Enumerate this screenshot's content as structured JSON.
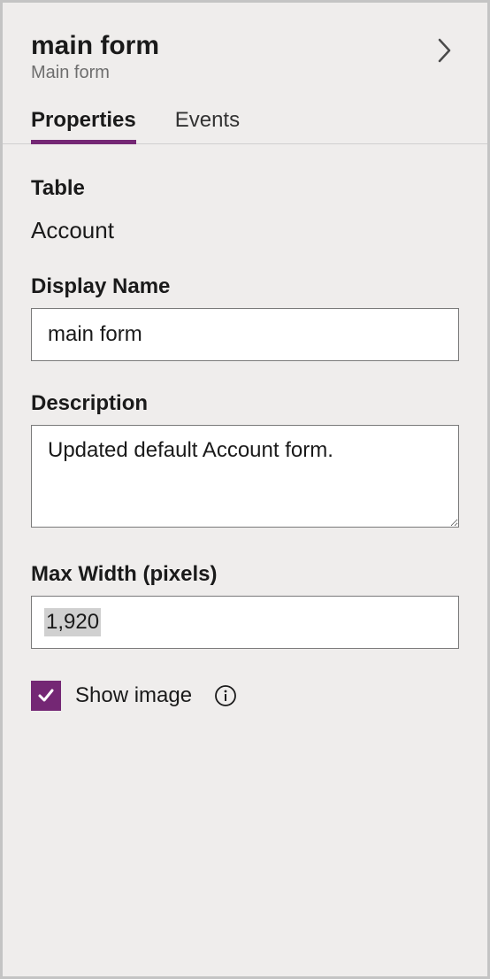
{
  "header": {
    "title": "main form",
    "subtitle": "Main form"
  },
  "tabs": {
    "properties": "Properties",
    "events": "Events"
  },
  "fields": {
    "table": {
      "label": "Table",
      "value": "Account"
    },
    "displayName": {
      "label": "Display Name",
      "value": "main form"
    },
    "description": {
      "label": "Description",
      "value": "Updated default Account form."
    },
    "maxWidth": {
      "label": "Max Width (pixels)",
      "value": "1,920"
    },
    "showImage": {
      "label": "Show image",
      "checked": true
    }
  },
  "colors": {
    "accent": "#742774"
  }
}
